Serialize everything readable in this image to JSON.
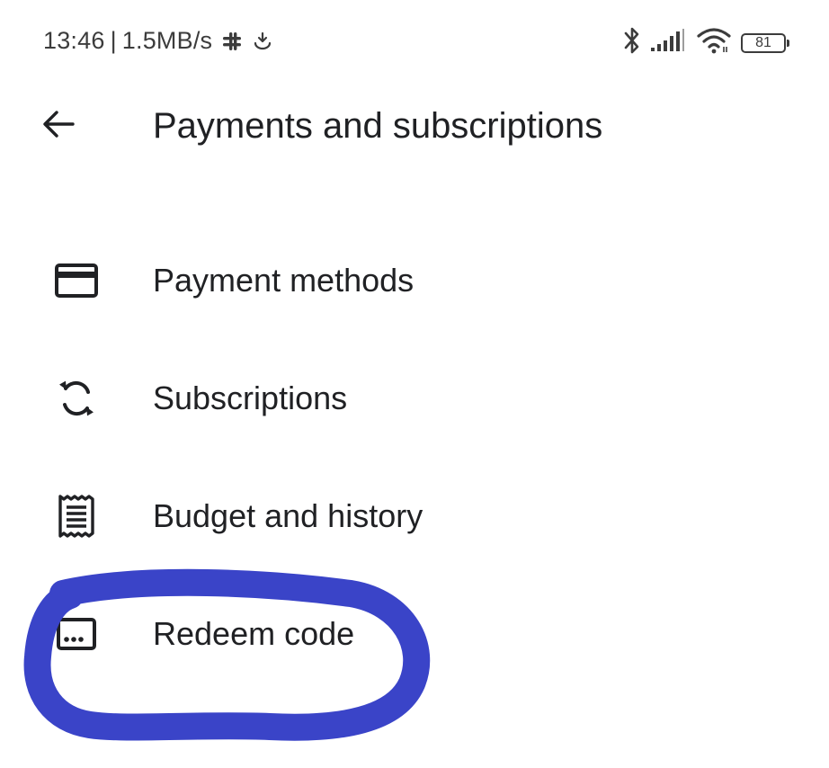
{
  "status_bar": {
    "time": "13:46",
    "separator": "|",
    "speed": "1.5MB/s",
    "battery": "81",
    "icons": [
      "slack-icon",
      "download-icon",
      "bluetooth-icon",
      "signal-icon",
      "wifi-icon",
      "battery-icon"
    ]
  },
  "app_bar": {
    "title": "Payments and subscriptions",
    "back_icon": "arrow-back-icon"
  },
  "menu": {
    "items": [
      {
        "label": "Payment methods",
        "icon": "credit-card-icon"
      },
      {
        "label": "Subscriptions",
        "icon": "sync-icon"
      },
      {
        "label": "Budget and history",
        "icon": "receipt-icon"
      },
      {
        "label": "Redeem code",
        "icon": "redeem-card-icon"
      }
    ]
  },
  "colors": {
    "text": "#202124",
    "status_text": "#3c3c3c",
    "annotation": "#3a44c8",
    "background": "#ffffff"
  }
}
